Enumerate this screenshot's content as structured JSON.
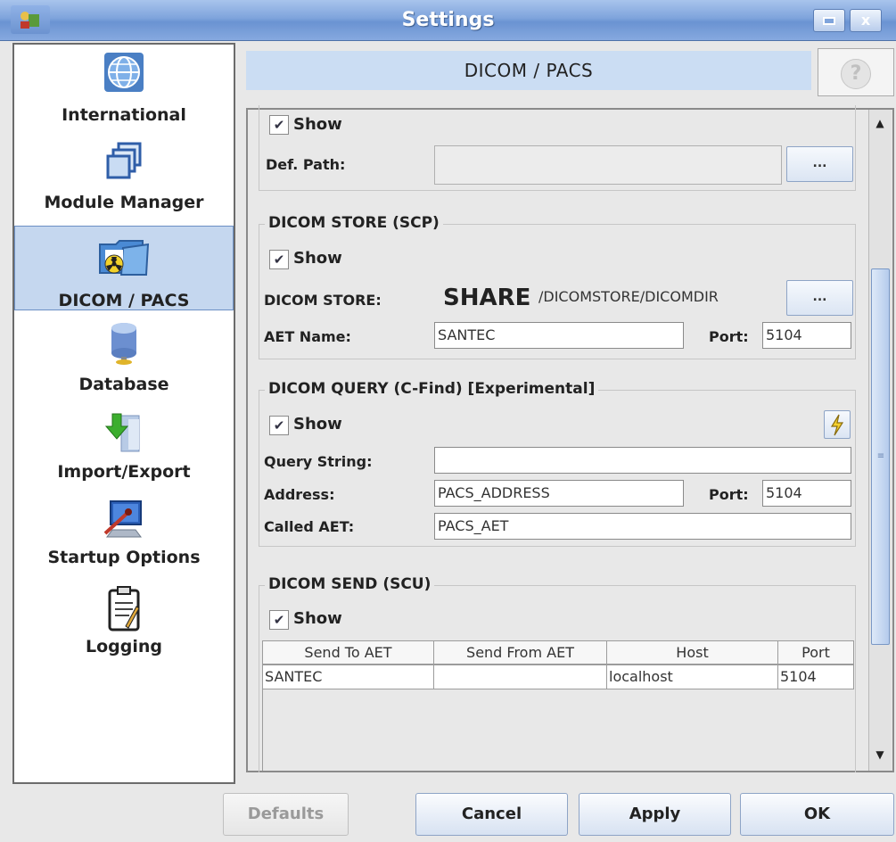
{
  "window": {
    "title": "Settings"
  },
  "sidebar": {
    "items": [
      {
        "label": "International",
        "icon": "globe-icon"
      },
      {
        "label": "Module Manager",
        "icon": "windows-stack-icon"
      },
      {
        "label": "DICOM / PACS",
        "icon": "radiation-folder-icon",
        "selected": true
      },
      {
        "label": "Database",
        "icon": "database-icon"
      },
      {
        "label": "Import/Export",
        "icon": "import-export-icon"
      },
      {
        "label": "Startup Options",
        "icon": "computer-icon"
      },
      {
        "label": "Logging",
        "icon": "clipboard-icon"
      }
    ]
  },
  "header": {
    "title": "DICOM / PACS",
    "help": "?"
  },
  "sections": {
    "top": {
      "show_label": "Show",
      "def_path_label": "Def. Path:",
      "def_path_value": "",
      "browse_label": "..."
    },
    "store": {
      "title": "DICOM STORE (SCP)",
      "show_label": "Show",
      "store_label": "DICOM STORE:",
      "share": "SHARE",
      "path": "/DICOMSTORE/DICOMDIR",
      "browse_label": "...",
      "aet_label": "AET Name:",
      "aet_value": "SANTEC",
      "port_label": "Port:",
      "port_value": "5104"
    },
    "query": {
      "title": "DICOM QUERY (C-Find) [Experimental]",
      "show_label": "Show",
      "query_label": "Query String:",
      "query_value": "",
      "address_label": "Address:",
      "address_value": "PACS_ADDRESS",
      "port_label": "Port:",
      "port_value": "5104",
      "called_label": "Called AET:",
      "called_value": "PACS_AET"
    },
    "send": {
      "title": "DICOM SEND (SCU)",
      "show_label": "Show",
      "columns": [
        "Send To AET",
        "Send From AET",
        "Host",
        "Port"
      ],
      "rows": [
        [
          "SANTEC",
          "",
          "localhost",
          "5104"
        ]
      ]
    }
  },
  "buttons": {
    "defaults": "Defaults",
    "cancel": "Cancel",
    "apply": "Apply",
    "ok": "OK"
  },
  "colors": {
    "titlebar": "#7fa4dc",
    "selected": "#c5d7ef",
    "header": "#cbddf3"
  }
}
